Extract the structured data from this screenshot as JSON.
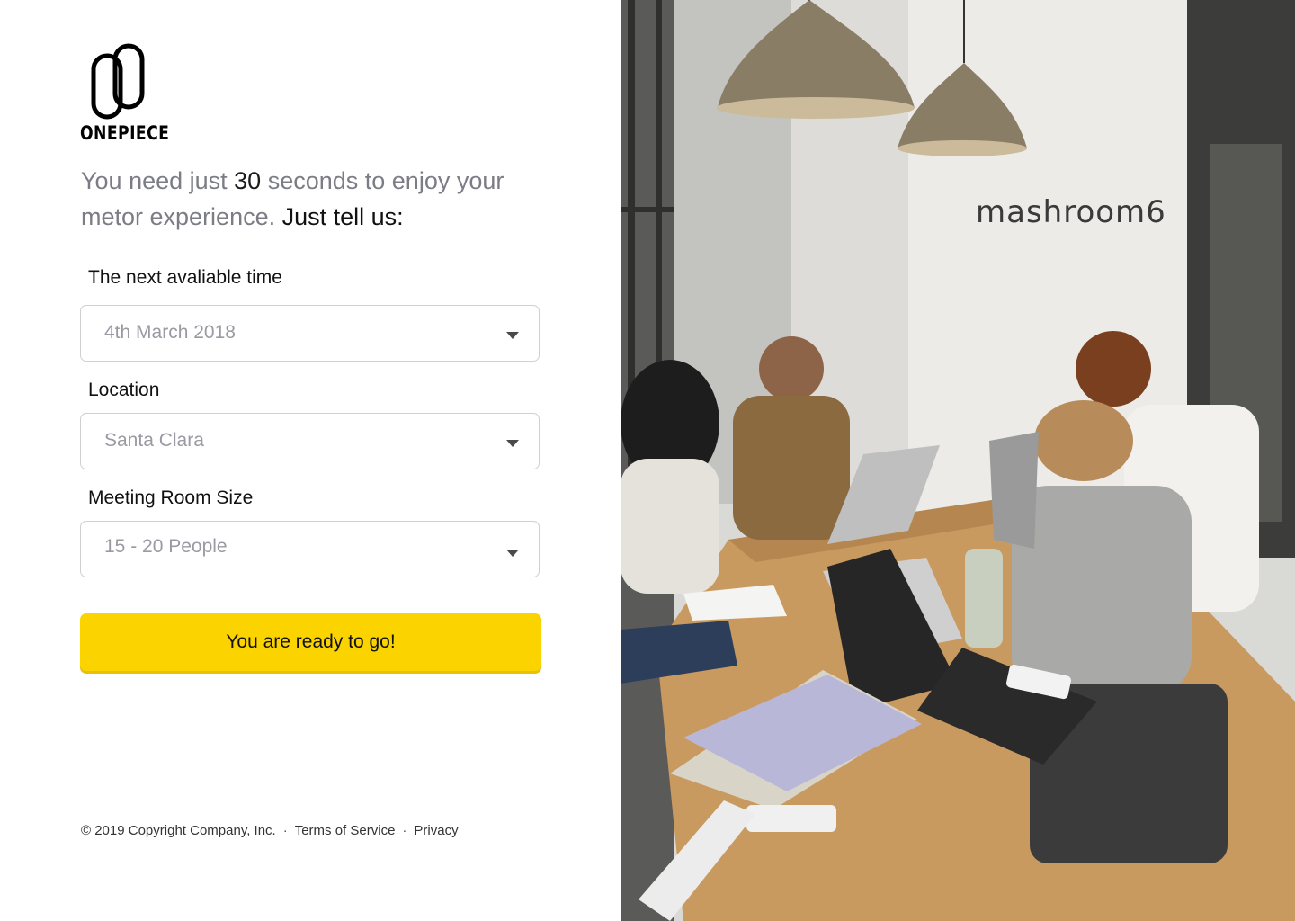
{
  "brand": {
    "name": "ONEPIECE"
  },
  "headline": {
    "part1": "You need just ",
    "number": "30",
    "part2": " seconds to enjoy your metor experience. ",
    "cta": "Just tell us:"
  },
  "form": {
    "time": {
      "label": "The next avaliable time",
      "value": "4th March 2018"
    },
    "location": {
      "label": "Location",
      "value": "Santa Clara"
    },
    "room_size": {
      "label": "Meeting Room Size",
      "value": "15 - 20 People"
    },
    "submit_label": "You are ready to go!"
  },
  "footer": {
    "copyright": "© 2019 Copyright Company, Inc.",
    "separator": "·",
    "terms": "Terms of Service",
    "privacy": "Privacy"
  },
  "photo": {
    "sign_text": "mashroom6"
  },
  "colors": {
    "accent": "#fbd400",
    "muted_text": "#7c7c86",
    "border": "#cfcfd4"
  },
  "icons": {
    "caret": "caret-down-icon",
    "logo": "paperclip-logo-icon"
  }
}
